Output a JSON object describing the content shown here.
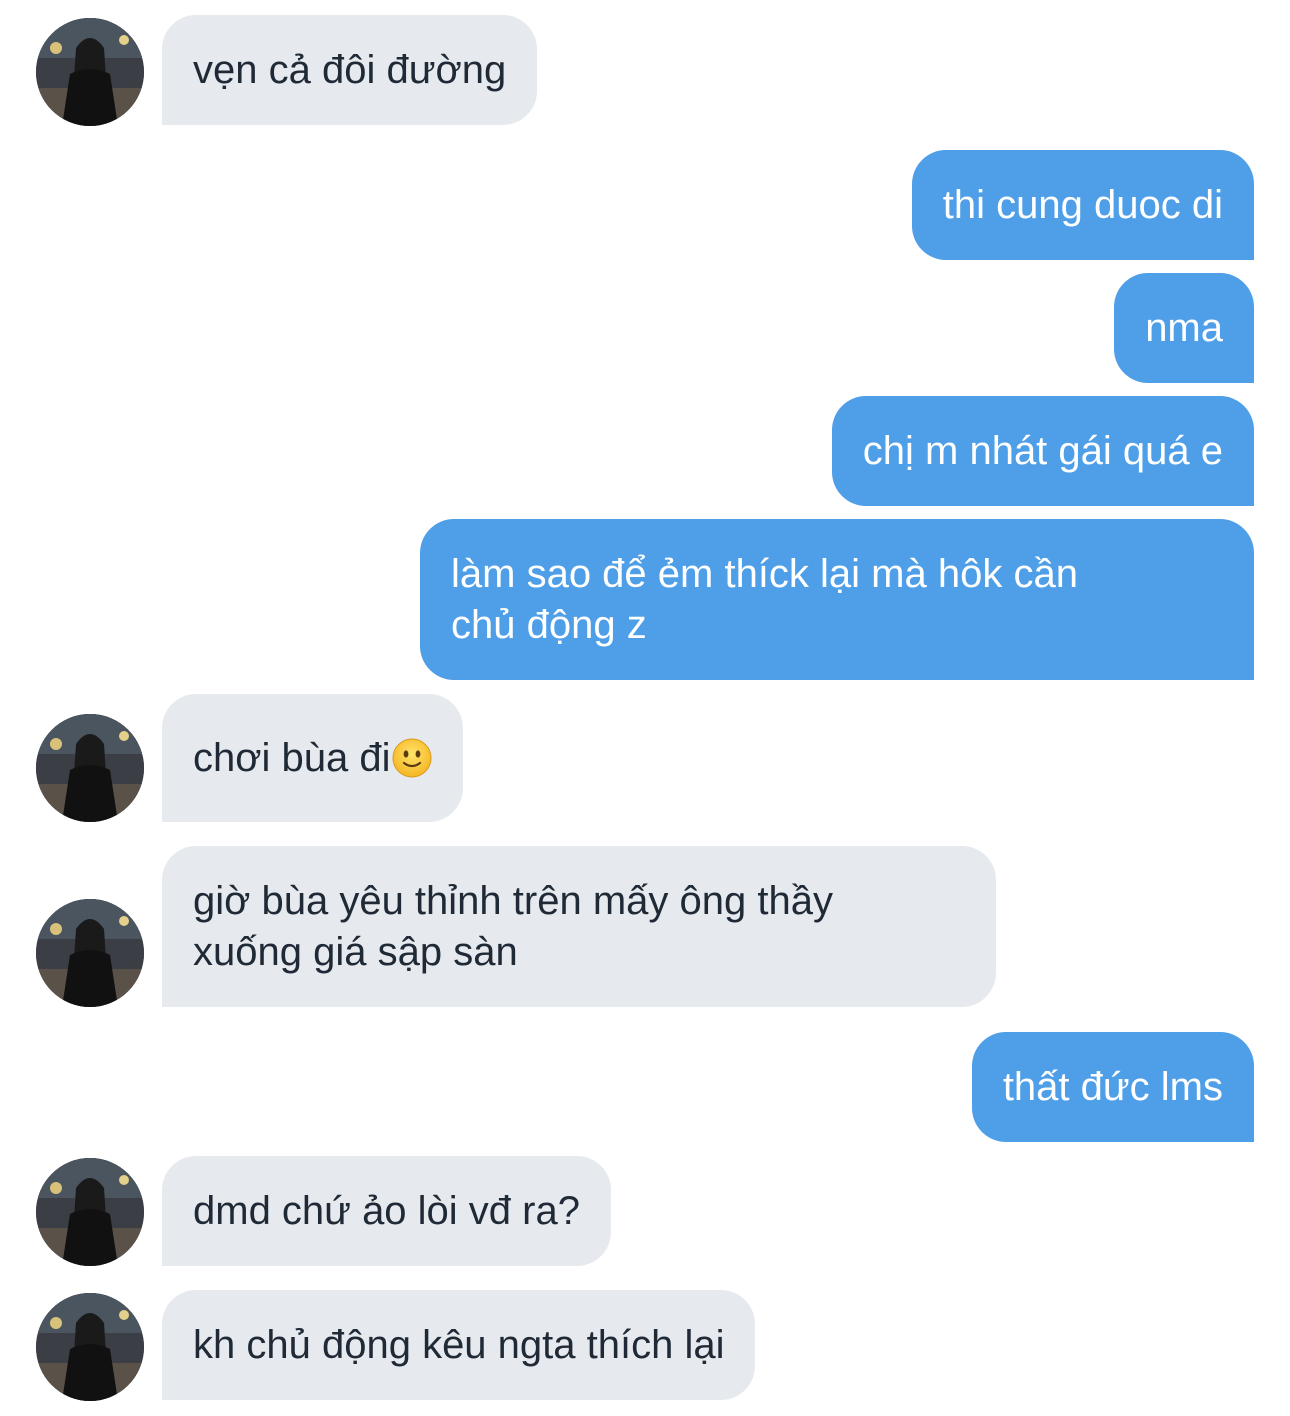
{
  "messages": [
    {
      "side": "in",
      "text": "vẹn cả đôi đường",
      "avatar": true
    },
    {
      "side": "out",
      "text": "thi cung duoc di"
    },
    {
      "side": "out",
      "text": "nma"
    },
    {
      "side": "out",
      "text": "chị m nhát gái quá e"
    },
    {
      "side": "out",
      "text": "làm sao để ẻm thíck lại mà hôk cần\nchủ động z"
    },
    {
      "side": "in",
      "text": "chơi bùa đi",
      "emoji": "slightly-smiling-face-icon",
      "avatar": true
    },
    {
      "side": "in",
      "text": "giờ bùa yêu thỉnh trên mấy ông thầy\nxuống giá sập sàn",
      "avatar": true
    },
    {
      "side": "out",
      "text": "thất đức lms"
    },
    {
      "side": "in",
      "text": "dmd chứ ảo lòi vđ ra?",
      "avatar": true
    },
    {
      "side": "in",
      "text": "kh chủ động kêu ngta thích lại",
      "avatar": true
    }
  ],
  "colors": {
    "incoming_bubble": "#e6e9ee",
    "incoming_text": "#1f2a36",
    "outgoing_bubble": "#4e9ee8",
    "outgoing_text": "#ffffff"
  }
}
